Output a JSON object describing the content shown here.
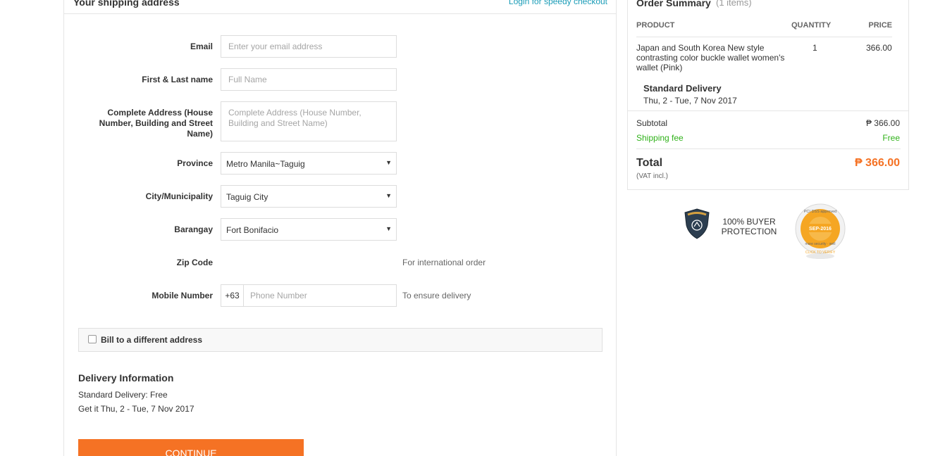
{
  "shipping": {
    "title": "Your shipping address",
    "speedy_link": "Login for speedy checkout",
    "fields": {
      "email": {
        "label": "Email",
        "placeholder": "Enter your email address",
        "value": ""
      },
      "name": {
        "label": "First & Last name",
        "placeholder": "Full Name",
        "value": ""
      },
      "address": {
        "label": "Complete Address (House Number, Building and Street Name)",
        "placeholder": "Complete Address (House Number, Building and Street Name)",
        "value": ""
      },
      "province": {
        "label": "Province",
        "value": "Metro Manila~Taguig"
      },
      "city": {
        "label": "City/Municipality",
        "value": "Taguig City"
      },
      "barangay": {
        "label": "Barangay",
        "value": "Fort Bonifacio"
      },
      "zip": {
        "label": "Zip Code",
        "hint": "For international order"
      },
      "mobile": {
        "label": "Mobile Number",
        "prefix": "+63",
        "placeholder": "Phone Number",
        "hint": "To ensure delivery",
        "value": ""
      }
    },
    "bill_different": {
      "label": "Bill to a different address",
      "checked": false
    },
    "delivery": {
      "title": "Delivery Information",
      "line1": "Standard Delivery: Free",
      "line2": "Get it Thu, 2 - Tue, 7 Nov 2017"
    },
    "continue_label": "CONTINUE"
  },
  "summary": {
    "title": "Order Summary",
    "count": "(1 items)",
    "headers": {
      "product": "PRODUCT",
      "quantity": "QUANTITY",
      "price": "PRICE"
    },
    "item": {
      "name": "Japan and South Korea New style contrasting color buckle wallet women's wallet (Pink)",
      "quantity": "1",
      "price": "366.00"
    },
    "shipping_method": {
      "title": "Standard Delivery",
      "date": "Thu, 2 - Tue, 7 Nov 2017"
    },
    "subtotal_label": "Subtotal",
    "subtotal_value": "₱ 366.00",
    "fee_label": "Shipping fee",
    "fee_value": "Free",
    "total_label": "Total",
    "total_value": "₱ 366.00",
    "vat": "(VAT incl.)"
  },
  "trust": {
    "buyer_protection": "100% BUYER PROTECTION",
    "pci_top": "PCI DSS approved",
    "pci_date": "SEP-2016",
    "pci_bottom": "more security · well",
    "pci_verify": "CLICK TO VERIFY"
  },
  "colors": {
    "accent": "#f57224",
    "link": "#1a9cb7",
    "free": "#30b21a"
  }
}
